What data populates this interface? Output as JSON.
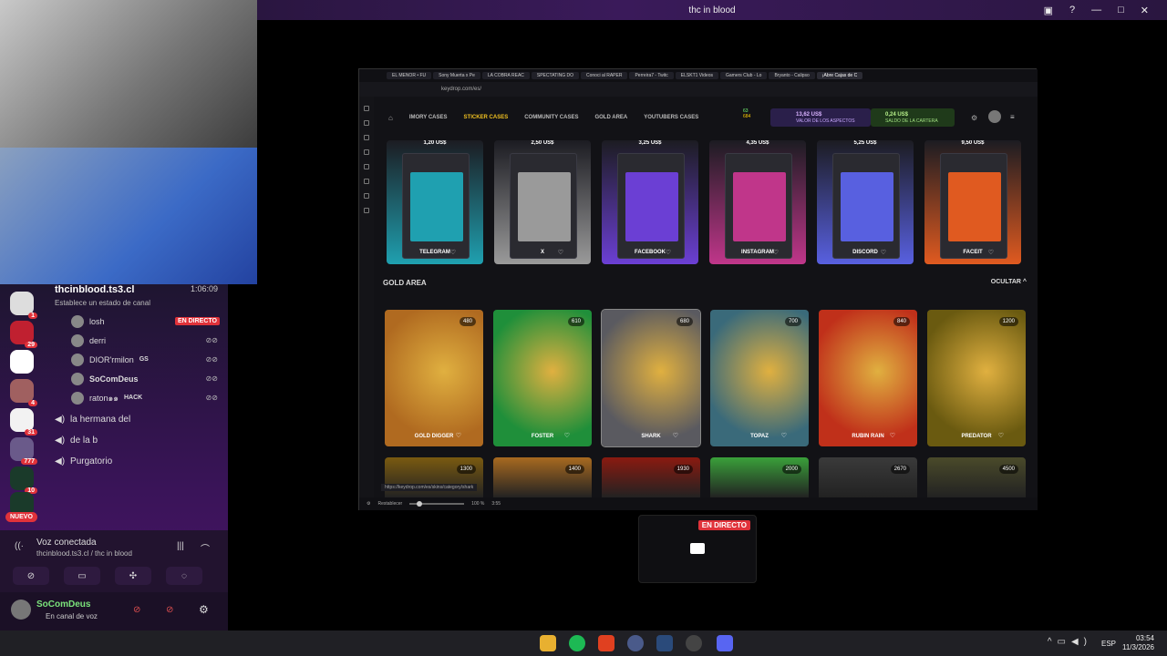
{
  "window_title": "thc in blood",
  "discord": {
    "channel_name": "thcinblood.ts3.cl",
    "elapsed": "1:06:09",
    "status_prompt": "Establece un estado de canal",
    "servers": [
      {
        "badge": "1"
      },
      {
        "badge": "29"
      },
      {
        "badge": ""
      },
      {
        "badge": "4"
      },
      {
        "badge": "31"
      },
      {
        "badge": "777"
      },
      {
        "badge": "10"
      },
      {
        "badge": ""
      }
    ],
    "new_label": "NUEVO",
    "voice_users": [
      {
        "name": "losh",
        "tag": "EN DIRECTO"
      },
      {
        "name": "derri",
        "tag": ""
      },
      {
        "name": "DIOR'rmilon",
        "tag": "GS"
      },
      {
        "name": "SoComDeus",
        "tag": ""
      },
      {
        "name": "raton๑๑",
        "tag": "HACK"
      }
    ],
    "voice_channels": [
      "la hermana del",
      "de la b",
      "Purgatorio"
    ],
    "voice_connected": "Voz conectada",
    "voice_path": "thcinblood.ts3.cl / thc in blood",
    "user_name": "SoComDeus",
    "user_status": "En canal de voz"
  },
  "browser": {
    "tabs": [
      "EL MENOR • FU",
      "Sony Muerta x Pe",
      "LA COBRA REAC",
      "SPECTATING DO",
      "Conoci al RAPER",
      "Perreira7 - Twitc",
      "ELSKT1 Videos",
      "Gamers Club - Lo",
      "Bryanto - Calipso",
      "¡Abre Cajas de C"
    ],
    "url": "keydrop.com/es/",
    "nav": [
      "IMORY CASES",
      "STICKER CASES",
      "COMMUNITY CASES",
      "GOLD AREA",
      "YOUTUBERS CASES"
    ],
    "active_nav": "STICKER CASES",
    "small_balances": [
      "63",
      "684"
    ],
    "skin_value": "13,62 US$",
    "skin_value_label": "VALOR DE LOS ASPECTOS",
    "wallet_value": "0,24 US$",
    "wallet_label": "SALDO DE LA CARTERA",
    "sticker_cases": [
      {
        "price": "1,20 US$",
        "name": "TELEGRAM",
        "color": "#1fa0b0"
      },
      {
        "price": "2,50 US$",
        "name": "X",
        "color": "#9a9a9a"
      },
      {
        "price": "3,25 US$",
        "name": "FACEBOOK",
        "color": "#6b3fd4"
      },
      {
        "price": "4,35 US$",
        "name": "INSTAGRAM",
        "color": "#c0368a"
      },
      {
        "price": "5,25 US$",
        "name": "DISCORD",
        "color": "#5860e0"
      },
      {
        "price": "9,50 US$",
        "name": "FACEIT",
        "color": "#e05a20"
      }
    ],
    "gold_title": "GOLD AREA",
    "hide_label": "OCULTAR",
    "gold_cases": [
      {
        "price": "480",
        "name": "GOLD DIGGER",
        "color": "#b06a20"
      },
      {
        "price": "610",
        "name": "FOSTER",
        "color": "#1f8f3a"
      },
      {
        "price": "680",
        "name": "SHARK",
        "color": "#5a5a60"
      },
      {
        "price": "700",
        "name": "TOPAZ",
        "color": "#3a6a7a"
      },
      {
        "price": "840",
        "name": "RUBIN RAIN",
        "color": "#c0301a"
      },
      {
        "price": "1200",
        "name": "PREDATOR",
        "color": "#6a5a10"
      }
    ],
    "more_cases": [
      {
        "price": "1300",
        "color": "#7a5a10"
      },
      {
        "price": "1400",
        "color": "#a86a20"
      },
      {
        "price": "1930",
        "color": "#8a1a10"
      },
      {
        "price": "2000",
        "color": "#3aa03a"
      },
      {
        "price": "2670",
        "color": "#3a3a3a"
      },
      {
        "price": "4500",
        "color": "#4a4a2a"
      }
    ],
    "status_url": "https://keydrop.com/es/skins/category/shark",
    "footer_reset": "Restablecer",
    "zoom": "100 %",
    "footer_time": "3:55"
  },
  "stream_live": "EN DIRECTO",
  "taskbar": {
    "lang": "ESP",
    "time": "03:54",
    "date": "11/3/2026"
  }
}
